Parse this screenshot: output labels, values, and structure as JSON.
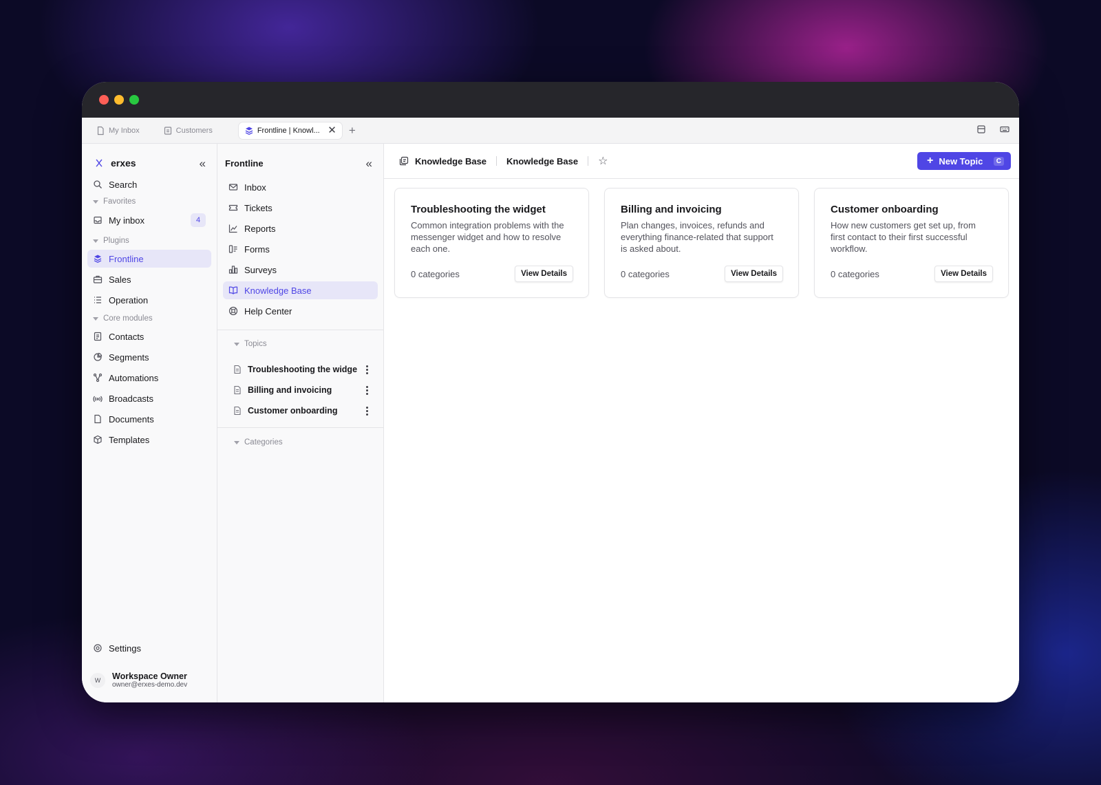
{
  "tabs": [
    {
      "label": "My Inbox",
      "icon": "file-icon"
    },
    {
      "label": "Customers",
      "icon": "contacts-icon"
    },
    {
      "label": "Frontline | Knowl...",
      "icon": "frontline-icon",
      "active": true
    }
  ],
  "brand": {
    "name": "erxes"
  },
  "sidebar": {
    "search": "Search",
    "favorites_label": "Favorites",
    "my_inbox": {
      "label": "My inbox",
      "badge": "4"
    },
    "plugins_label": "Plugins",
    "plugins": [
      {
        "label": "Frontline",
        "icon": "frontline-icon"
      },
      {
        "label": "Sales",
        "icon": "briefcase-icon"
      },
      {
        "label": "Operation",
        "icon": "list-icon"
      }
    ],
    "core_label": "Core modules",
    "core": [
      {
        "label": "Contacts",
        "icon": "contacts-icon"
      },
      {
        "label": "Segments",
        "icon": "pie-icon"
      },
      {
        "label": "Automations",
        "icon": "automation-icon"
      },
      {
        "label": "Broadcasts",
        "icon": "broadcast-icon"
      },
      {
        "label": "Documents",
        "icon": "file-icon"
      },
      {
        "label": "Templates",
        "icon": "box-icon"
      }
    ],
    "settings": "Settings",
    "user": {
      "initial": "W",
      "name": "Workspace Owner",
      "email": "owner@erxes-demo.dev"
    }
  },
  "frontline": {
    "title": "Frontline",
    "items": [
      {
        "label": "Inbox",
        "icon": "mail-icon"
      },
      {
        "label": "Tickets",
        "icon": "ticket-icon"
      },
      {
        "label": "Reports",
        "icon": "chart-icon"
      },
      {
        "label": "Forms",
        "icon": "form-icon"
      },
      {
        "label": "Surveys",
        "icon": "bar-chart-icon"
      },
      {
        "label": "Knowledge Base",
        "icon": "book-icon",
        "active": true
      },
      {
        "label": "Help Center",
        "icon": "lifebuoy-icon"
      }
    ],
    "topics_label": "Topics",
    "topics": [
      {
        "label": "Troubleshooting the widget"
      },
      {
        "label": "Billing and invoicing"
      },
      {
        "label": "Customer onboarding"
      }
    ],
    "categories_label": "Categories"
  },
  "header": {
    "crumb1": "Knowledge Base",
    "crumb2": "Knowledge Base",
    "new_topic": "New Topic",
    "shortcut": "C"
  },
  "cards": [
    {
      "title": "Troubleshooting the widget",
      "description": "Common integration problems with the messenger widget and how to resolve each one.",
      "count": "0 categories",
      "button": "View Details"
    },
    {
      "title": "Billing and invoicing",
      "description": "Plan changes, invoices, refunds and everything finance-related that support is asked about.",
      "count": "0 categories",
      "button": "View Details"
    },
    {
      "title": "Customer onboarding",
      "description": "How new customers get set up, from first contact to their first successful workflow.",
      "count": "0 categories",
      "button": "View Details"
    }
  ],
  "colors": {
    "accent": "#4f46e5",
    "active_bg": "#e7e6f8"
  }
}
